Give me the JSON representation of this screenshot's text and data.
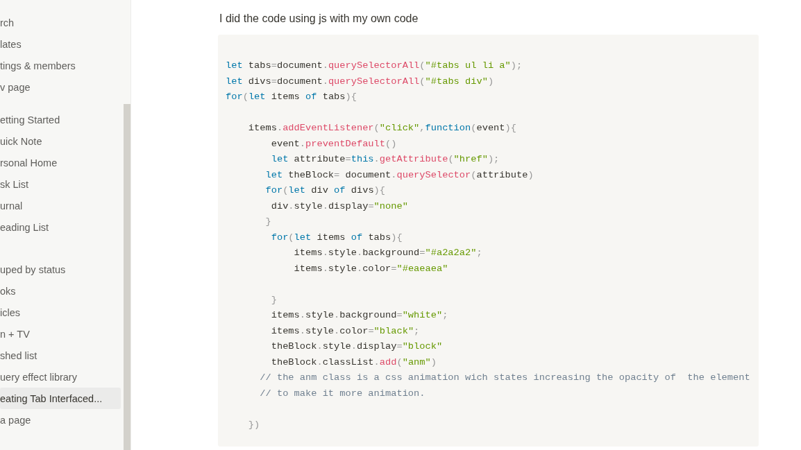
{
  "sidebar": {
    "sections": [
      {
        "items": [
          {
            "label": "rch",
            "selected": false
          },
          {
            "label": "lates",
            "selected": false
          },
          {
            "label": "tings & members",
            "selected": false
          },
          {
            "label": "v page",
            "selected": false
          }
        ]
      },
      {
        "items": [
          {
            "label": "etting Started",
            "selected": false
          },
          {
            "label": "uick Note",
            "selected": false
          },
          {
            "label": "rsonal Home",
            "selected": false
          },
          {
            "label": "sk List",
            "selected": false
          },
          {
            "label": "urnal",
            "selected": false
          },
          {
            "label": "eading List",
            "selected": false
          }
        ]
      },
      {
        "items": [
          {
            "label": "uped by status",
            "selected": false
          },
          {
            "label": "oks",
            "selected": false
          },
          {
            "label": "icles",
            "selected": false
          },
          {
            "label": "n + TV",
            "selected": false
          },
          {
            "label": "shed list",
            "selected": false
          },
          {
            "label": "uery effect library",
            "selected": false
          },
          {
            "label": "eating Tab Interfaced...",
            "selected": true
          },
          {
            "label": "a page",
            "selected": false
          }
        ]
      }
    ]
  },
  "page": {
    "paragraph": "I did the code using js with my own code",
    "code_block": {
      "lines": [
        {
          "tokens": [
            {
              "kind": "keyword",
              "text": "let"
            },
            {
              "kind": "plain",
              "text": " tabs"
            },
            {
              "kind": "punctuation",
              "text": "="
            },
            {
              "kind": "plain",
              "text": "document"
            },
            {
              "kind": "punctuation",
              "text": "."
            },
            {
              "kind": "function",
              "text": "querySelectorAll"
            },
            {
              "kind": "punctuation",
              "text": "("
            },
            {
              "kind": "string",
              "text": "\"#tabs ul li a\""
            },
            {
              "kind": "punctuation",
              "text": ");"
            }
          ]
        },
        {
          "tokens": [
            {
              "kind": "keyword",
              "text": "let"
            },
            {
              "kind": "plain",
              "text": " divs"
            },
            {
              "kind": "punctuation",
              "text": "="
            },
            {
              "kind": "plain",
              "text": "document"
            },
            {
              "kind": "punctuation",
              "text": "."
            },
            {
              "kind": "function",
              "text": "querySelectorAll"
            },
            {
              "kind": "punctuation",
              "text": "("
            },
            {
              "kind": "string",
              "text": "\"#tabs div\""
            },
            {
              "kind": "punctuation",
              "text": ")"
            }
          ]
        },
        {
          "tokens": [
            {
              "kind": "keyword",
              "text": "for"
            },
            {
              "kind": "punctuation",
              "text": "("
            },
            {
              "kind": "keyword",
              "text": "let"
            },
            {
              "kind": "plain",
              "text": " items "
            },
            {
              "kind": "keyword",
              "text": "of"
            },
            {
              "kind": "plain",
              "text": " tabs"
            },
            {
              "kind": "punctuation",
              "text": "){"
            }
          ]
        },
        {
          "kind": "blank"
        },
        {
          "tokens": [
            {
              "kind": "plain",
              "text": "    items"
            },
            {
              "kind": "punctuation",
              "text": "."
            },
            {
              "kind": "function",
              "text": "addEventListener"
            },
            {
              "kind": "punctuation",
              "text": "("
            },
            {
              "kind": "string",
              "text": "\"click\""
            },
            {
              "kind": "punctuation",
              "text": ","
            },
            {
              "kind": "keyword",
              "text": "function"
            },
            {
              "kind": "punctuation",
              "text": "("
            },
            {
              "kind": "plain",
              "text": "event"
            },
            {
              "kind": "punctuation",
              "text": "){"
            }
          ]
        },
        {
          "tokens": [
            {
              "kind": "plain",
              "text": "        event"
            },
            {
              "kind": "punctuation",
              "text": "."
            },
            {
              "kind": "function",
              "text": "preventDefault"
            },
            {
              "kind": "punctuation",
              "text": "()"
            }
          ]
        },
        {
          "tokens": [
            {
              "kind": "keyword",
              "text": "        let"
            },
            {
              "kind": "plain",
              "text": " attribute"
            },
            {
              "kind": "punctuation",
              "text": "="
            },
            {
              "kind": "keyword",
              "text": "this"
            },
            {
              "kind": "punctuation",
              "text": "."
            },
            {
              "kind": "function",
              "text": "getAttribute"
            },
            {
              "kind": "punctuation",
              "text": "("
            },
            {
              "kind": "string",
              "text": "\"href\""
            },
            {
              "kind": "punctuation",
              "text": ");"
            }
          ]
        },
        {
          "tokens": [
            {
              "kind": "keyword",
              "text": "       let"
            },
            {
              "kind": "plain",
              "text": " theBlock"
            },
            {
              "kind": "punctuation",
              "text": "="
            },
            {
              "kind": "plain",
              "text": " document"
            },
            {
              "kind": "punctuation",
              "text": "."
            },
            {
              "kind": "function",
              "text": "querySelector"
            },
            {
              "kind": "punctuation",
              "text": "("
            },
            {
              "kind": "plain",
              "text": "attribute"
            },
            {
              "kind": "punctuation",
              "text": ")"
            }
          ]
        },
        {
          "tokens": [
            {
              "kind": "keyword",
              "text": "       for"
            },
            {
              "kind": "punctuation",
              "text": "("
            },
            {
              "kind": "keyword",
              "text": "let"
            },
            {
              "kind": "plain",
              "text": " div "
            },
            {
              "kind": "keyword",
              "text": "of"
            },
            {
              "kind": "plain",
              "text": " divs"
            },
            {
              "kind": "punctuation",
              "text": "){"
            }
          ]
        },
        {
          "tokens": [
            {
              "kind": "plain",
              "text": "        div"
            },
            {
              "kind": "punctuation",
              "text": "."
            },
            {
              "kind": "plain",
              "text": "style"
            },
            {
              "kind": "punctuation",
              "text": "."
            },
            {
              "kind": "plain",
              "text": "display"
            },
            {
              "kind": "punctuation",
              "text": "="
            },
            {
              "kind": "string",
              "text": "\"none\""
            }
          ]
        },
        {
          "tokens": [
            {
              "kind": "punctuation",
              "text": "       }"
            }
          ]
        },
        {
          "tokens": [
            {
              "kind": "keyword",
              "text": "        for"
            },
            {
              "kind": "punctuation",
              "text": "("
            },
            {
              "kind": "keyword",
              "text": "let"
            },
            {
              "kind": "plain",
              "text": " items "
            },
            {
              "kind": "keyword",
              "text": "of"
            },
            {
              "kind": "plain",
              "text": " tabs"
            },
            {
              "kind": "punctuation",
              "text": "){"
            }
          ]
        },
        {
          "tokens": [
            {
              "kind": "plain",
              "text": "            items"
            },
            {
              "kind": "punctuation",
              "text": "."
            },
            {
              "kind": "plain",
              "text": "style"
            },
            {
              "kind": "punctuation",
              "text": "."
            },
            {
              "kind": "plain",
              "text": "background"
            },
            {
              "kind": "punctuation",
              "text": "="
            },
            {
              "kind": "string",
              "text": "\"#a2a2a2\""
            },
            {
              "kind": "punctuation",
              "text": ";"
            }
          ]
        },
        {
          "tokens": [
            {
              "kind": "plain",
              "text": "            items"
            },
            {
              "kind": "punctuation",
              "text": "."
            },
            {
              "kind": "plain",
              "text": "style"
            },
            {
              "kind": "punctuation",
              "text": "."
            },
            {
              "kind": "plain",
              "text": "color"
            },
            {
              "kind": "punctuation",
              "text": "="
            },
            {
              "kind": "string",
              "text": "\"#eaeaea\""
            }
          ]
        },
        {
          "kind": "blank"
        },
        {
          "tokens": [
            {
              "kind": "punctuation",
              "text": "        }"
            }
          ]
        },
        {
          "tokens": [
            {
              "kind": "plain",
              "text": "        items"
            },
            {
              "kind": "punctuation",
              "text": "."
            },
            {
              "kind": "plain",
              "text": "style"
            },
            {
              "kind": "punctuation",
              "text": "."
            },
            {
              "kind": "plain",
              "text": "background"
            },
            {
              "kind": "punctuation",
              "text": "="
            },
            {
              "kind": "string",
              "text": "\"white\""
            },
            {
              "kind": "punctuation",
              "text": ";"
            }
          ]
        },
        {
          "tokens": [
            {
              "kind": "plain",
              "text": "        items"
            },
            {
              "kind": "punctuation",
              "text": "."
            },
            {
              "kind": "plain",
              "text": "style"
            },
            {
              "kind": "punctuation",
              "text": "."
            },
            {
              "kind": "plain",
              "text": "color"
            },
            {
              "kind": "punctuation",
              "text": "="
            },
            {
              "kind": "string",
              "text": "\"black\""
            },
            {
              "kind": "punctuation",
              "text": ";"
            }
          ]
        },
        {
          "tokens": [
            {
              "kind": "plain",
              "text": "        theBlock"
            },
            {
              "kind": "punctuation",
              "text": "."
            },
            {
              "kind": "plain",
              "text": "style"
            },
            {
              "kind": "punctuation",
              "text": "."
            },
            {
              "kind": "plain",
              "text": "display"
            },
            {
              "kind": "punctuation",
              "text": "="
            },
            {
              "kind": "string",
              "text": "\"block\""
            }
          ]
        },
        {
          "tokens": [
            {
              "kind": "plain",
              "text": "        theBlock"
            },
            {
              "kind": "punctuation",
              "text": "."
            },
            {
              "kind": "plain",
              "text": "classList"
            },
            {
              "kind": "punctuation",
              "text": "."
            },
            {
              "kind": "function",
              "text": "add"
            },
            {
              "kind": "punctuation",
              "text": "("
            },
            {
              "kind": "string",
              "text": "\"anm\""
            },
            {
              "kind": "punctuation",
              "text": ")"
            }
          ]
        },
        {
          "tokens": [
            {
              "kind": "comment",
              "text": "      // the anm class is a css animation wich states increasing the opacity of  the element"
            }
          ]
        },
        {
          "tokens": [
            {
              "kind": "comment",
              "text": "      // to make it more animation."
            }
          ]
        },
        {
          "kind": "blank"
        },
        {
          "tokens": [
            {
              "kind": "punctuation",
              "text": "    })"
            }
          ]
        }
      ]
    }
  }
}
